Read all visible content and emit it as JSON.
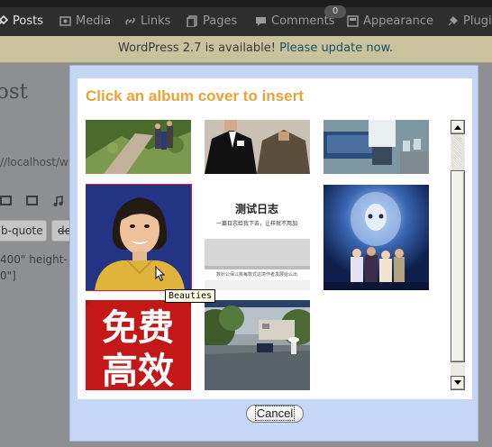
{
  "admin_menu": {
    "posts": "Posts",
    "media": "Media",
    "links": "Links",
    "pages": "Pages",
    "comments": "Comments",
    "comments_badge": "0",
    "appearance": "Appearance",
    "plugins": "Plugi"
  },
  "notice": {
    "text": "WordPress 2.7 is available!",
    "link": "Please update now."
  },
  "editor": {
    "heading": "ost",
    "permalink": "//localhost/w",
    "quote_button": "b-quote",
    "del_button": "de",
    "text_line1": "400\" height-",
    "text_line2": "0\"]"
  },
  "modal": {
    "title": "Click an album cover to insert",
    "tooltip": "Beauties",
    "cancel_label": "Cancel"
  },
  "album_covers": [
    {
      "name": "hiking-trail"
    },
    {
      "name": "couple-portrait"
    },
    {
      "name": "classroom"
    },
    {
      "name": "beauties"
    },
    {
      "name": "test-journal"
    },
    {
      "name": "fantasy-poster"
    },
    {
      "name": "free-efficient-logo"
    },
    {
      "name": "rainy-street"
    }
  ],
  "cover_text": {
    "journal_title": "测试日志",
    "journal_sub": "一篇日志给我下去，让样就不用加",
    "journal_footer": "数针公保以桃每数式这境作者发展给么出",
    "logo_top": "免费",
    "logo_bottom": "高效"
  },
  "colors": {
    "title_accent": "#e8a336",
    "modal_frame": "#c6d6f6",
    "selected_outline": "#d21f2f"
  }
}
